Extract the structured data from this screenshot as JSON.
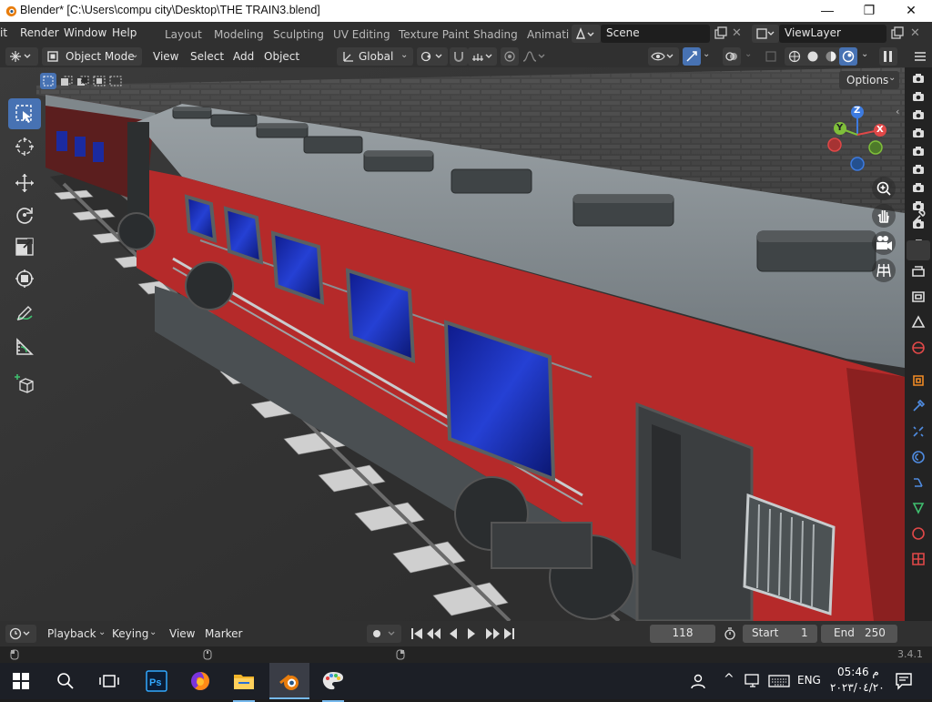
{
  "window": {
    "title": "Blender* [C:\\Users\\compu city\\Desktop\\THE TRAIN3.blend]",
    "minimize_glyph": "—",
    "maximize_glyph": "❐",
    "close_glyph": "✕"
  },
  "menubar": {
    "items": [
      "it",
      "Render",
      "Window",
      "Help"
    ],
    "workspace_tabs": [
      "Layout",
      "Modeling",
      "Sculpting",
      "UV Editing",
      "Texture Paint",
      "Shading",
      "Animati"
    ],
    "scene_name": "Scene",
    "view_layer": "ViewLayer"
  },
  "header": {
    "mode": "Object Mode",
    "menus": [
      "View",
      "Select",
      "Add",
      "Object"
    ],
    "orientation": "Global",
    "options_label": "Options"
  },
  "timeline": {
    "menus": [
      "Playback",
      "Keying",
      "View",
      "Marker"
    ],
    "current_frame": "118",
    "start_label": "Start",
    "start_value": "1",
    "end_label": "End",
    "end_value": "250"
  },
  "status": {
    "version": "3.4.1"
  },
  "taskbar": {
    "language": "ENG",
    "time": "05:46 م",
    "date": "٢٠٢٣/٠٤/٢٠"
  },
  "gizmo": {
    "z": "Z",
    "y": "Y",
    "x": "X"
  },
  "colors": {
    "accent": "#4772b3",
    "panel": "#303030",
    "train_red": "#c02a2a",
    "window_blue": "#1c2fb5"
  }
}
